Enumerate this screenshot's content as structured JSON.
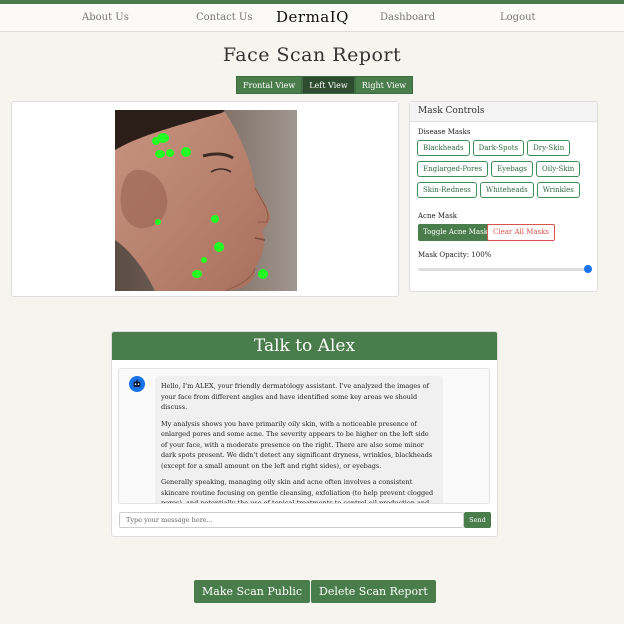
{
  "nav": {
    "about": "About Us",
    "contact": "Contact Us",
    "brand": "DermaIQ",
    "dashboard": "Dashboard",
    "logout": "Logout"
  },
  "page": {
    "title": "Face Scan Report"
  },
  "views": {
    "frontal": "Frontal View",
    "left": "Left View",
    "right": "Right View",
    "active": "Left View"
  },
  "mask_controls": {
    "title": "Mask Controls",
    "disease_label": "Disease Masks",
    "chips": [
      "Blackheads",
      "Dark-Spots",
      "Dry-Skin",
      "Englarged-Pores",
      "Eyebags",
      "Oily-Skin",
      "Skin-Redness",
      "Whiteheads",
      "Wrinkles"
    ],
    "acne_label": "Acne Mask",
    "toggle_acne": "Toggle Acne Mask",
    "clear_all": "Clear All Masks",
    "opacity_label": "Mask Opacity: 100%",
    "opacity": 1.0
  },
  "chat": {
    "title": "Talk to Alex",
    "messages": [
      "Hello, I'm ALEX, your friendly dermatology assistant. I've analyzed the images of your face from different angles and have identified some key areas we should discuss.",
      "My analysis shows you have primarily oily skin, with a noticeable presence of enlarged pores and some acne. The severity appears to be higher on the left side of your face, with a moderate presence on the right. There are also some minor dark spots present. We didn't detect any significant dryness, wrinkles, blackheads (except for a small amount on the left and right sides), or eyebags.",
      "Generally speaking, managing oily skin and acne often involves a consistent skincare routine focusing on gentle cleansing, exfoliation (to help prevent clogged pores), and potentially the use of topical treatments to control oil production and acne breakouts. A balanced diet and"
    ],
    "input_placeholder": "Type your message here...",
    "send": "Send"
  },
  "actions": {
    "make_public": "Make Scan Public",
    "delete_report": "Delete Scan Report"
  },
  "colors": {
    "primary": "#4a7d4c",
    "active_tab": "#2e4d30",
    "acne_marker": "#22ff22",
    "danger": "#d9534f",
    "avatar": "#1a73e8"
  }
}
